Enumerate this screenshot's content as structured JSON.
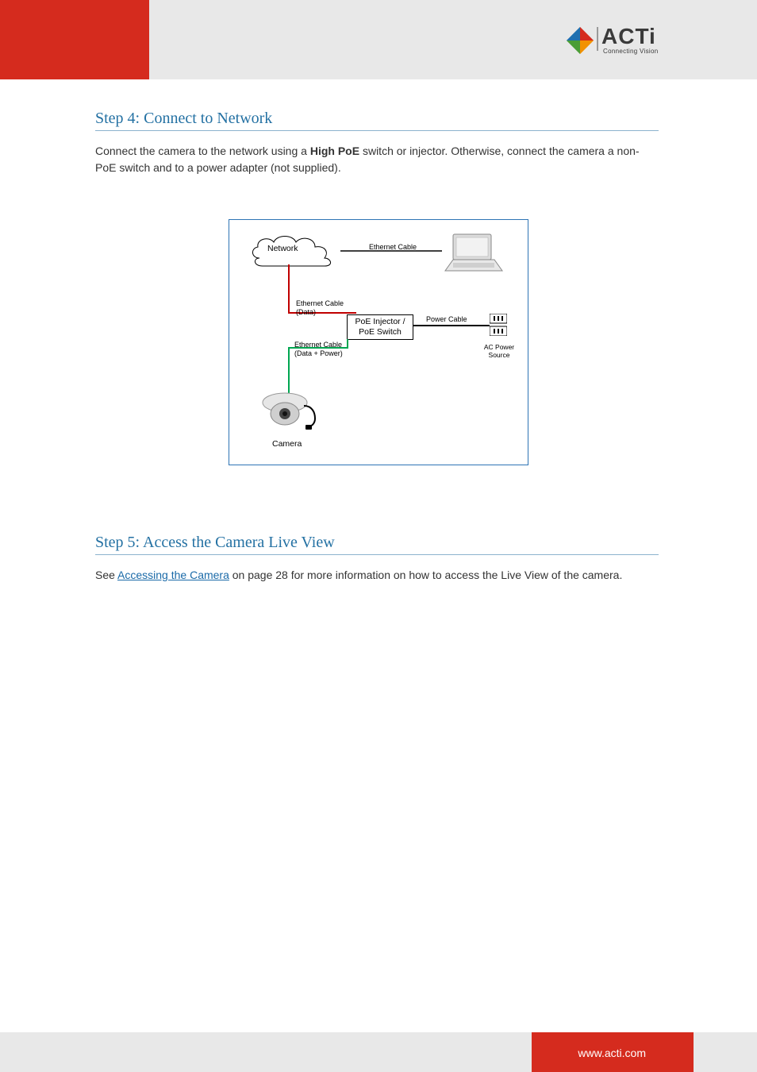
{
  "brand": {
    "name": "ACTi",
    "tagline": "Connecting Vision"
  },
  "section1": {
    "title": "Step 4: Connect to Network",
    "paragraph_parts": {
      "p1": "Connect the camera to the network using a ",
      "bold1": "High PoE",
      "p2": " switch or injector. Otherwise, connect the camera a non-PoE switch and to a power adapter (not supplied)."
    }
  },
  "diagram": {
    "network": "Network",
    "eth_top": "Ethernet Cable",
    "eth_data": "Ethernet Cable",
    "eth_data_sub": "(Data)",
    "poe_box_l1": "PoE Injector /",
    "poe_box_l2": "PoE Switch",
    "power_cable": "Power Cable",
    "ac_l1": "AC Power",
    "ac_l2": "Source",
    "eth_dp": "Ethernet Cable",
    "eth_dp_sub": "(Data + Power)",
    "camera": "Camera"
  },
  "section2": {
    "title": "Step 5: Access the Camera Live View",
    "para_parts": {
      "p1": "See ",
      "link": "Accessing the Camera",
      "p2": " on page ",
      "page": "28",
      "p3": " for more information on how to access the Live View of the camera."
    }
  },
  "footer": {
    "url": "www.acti.com"
  }
}
